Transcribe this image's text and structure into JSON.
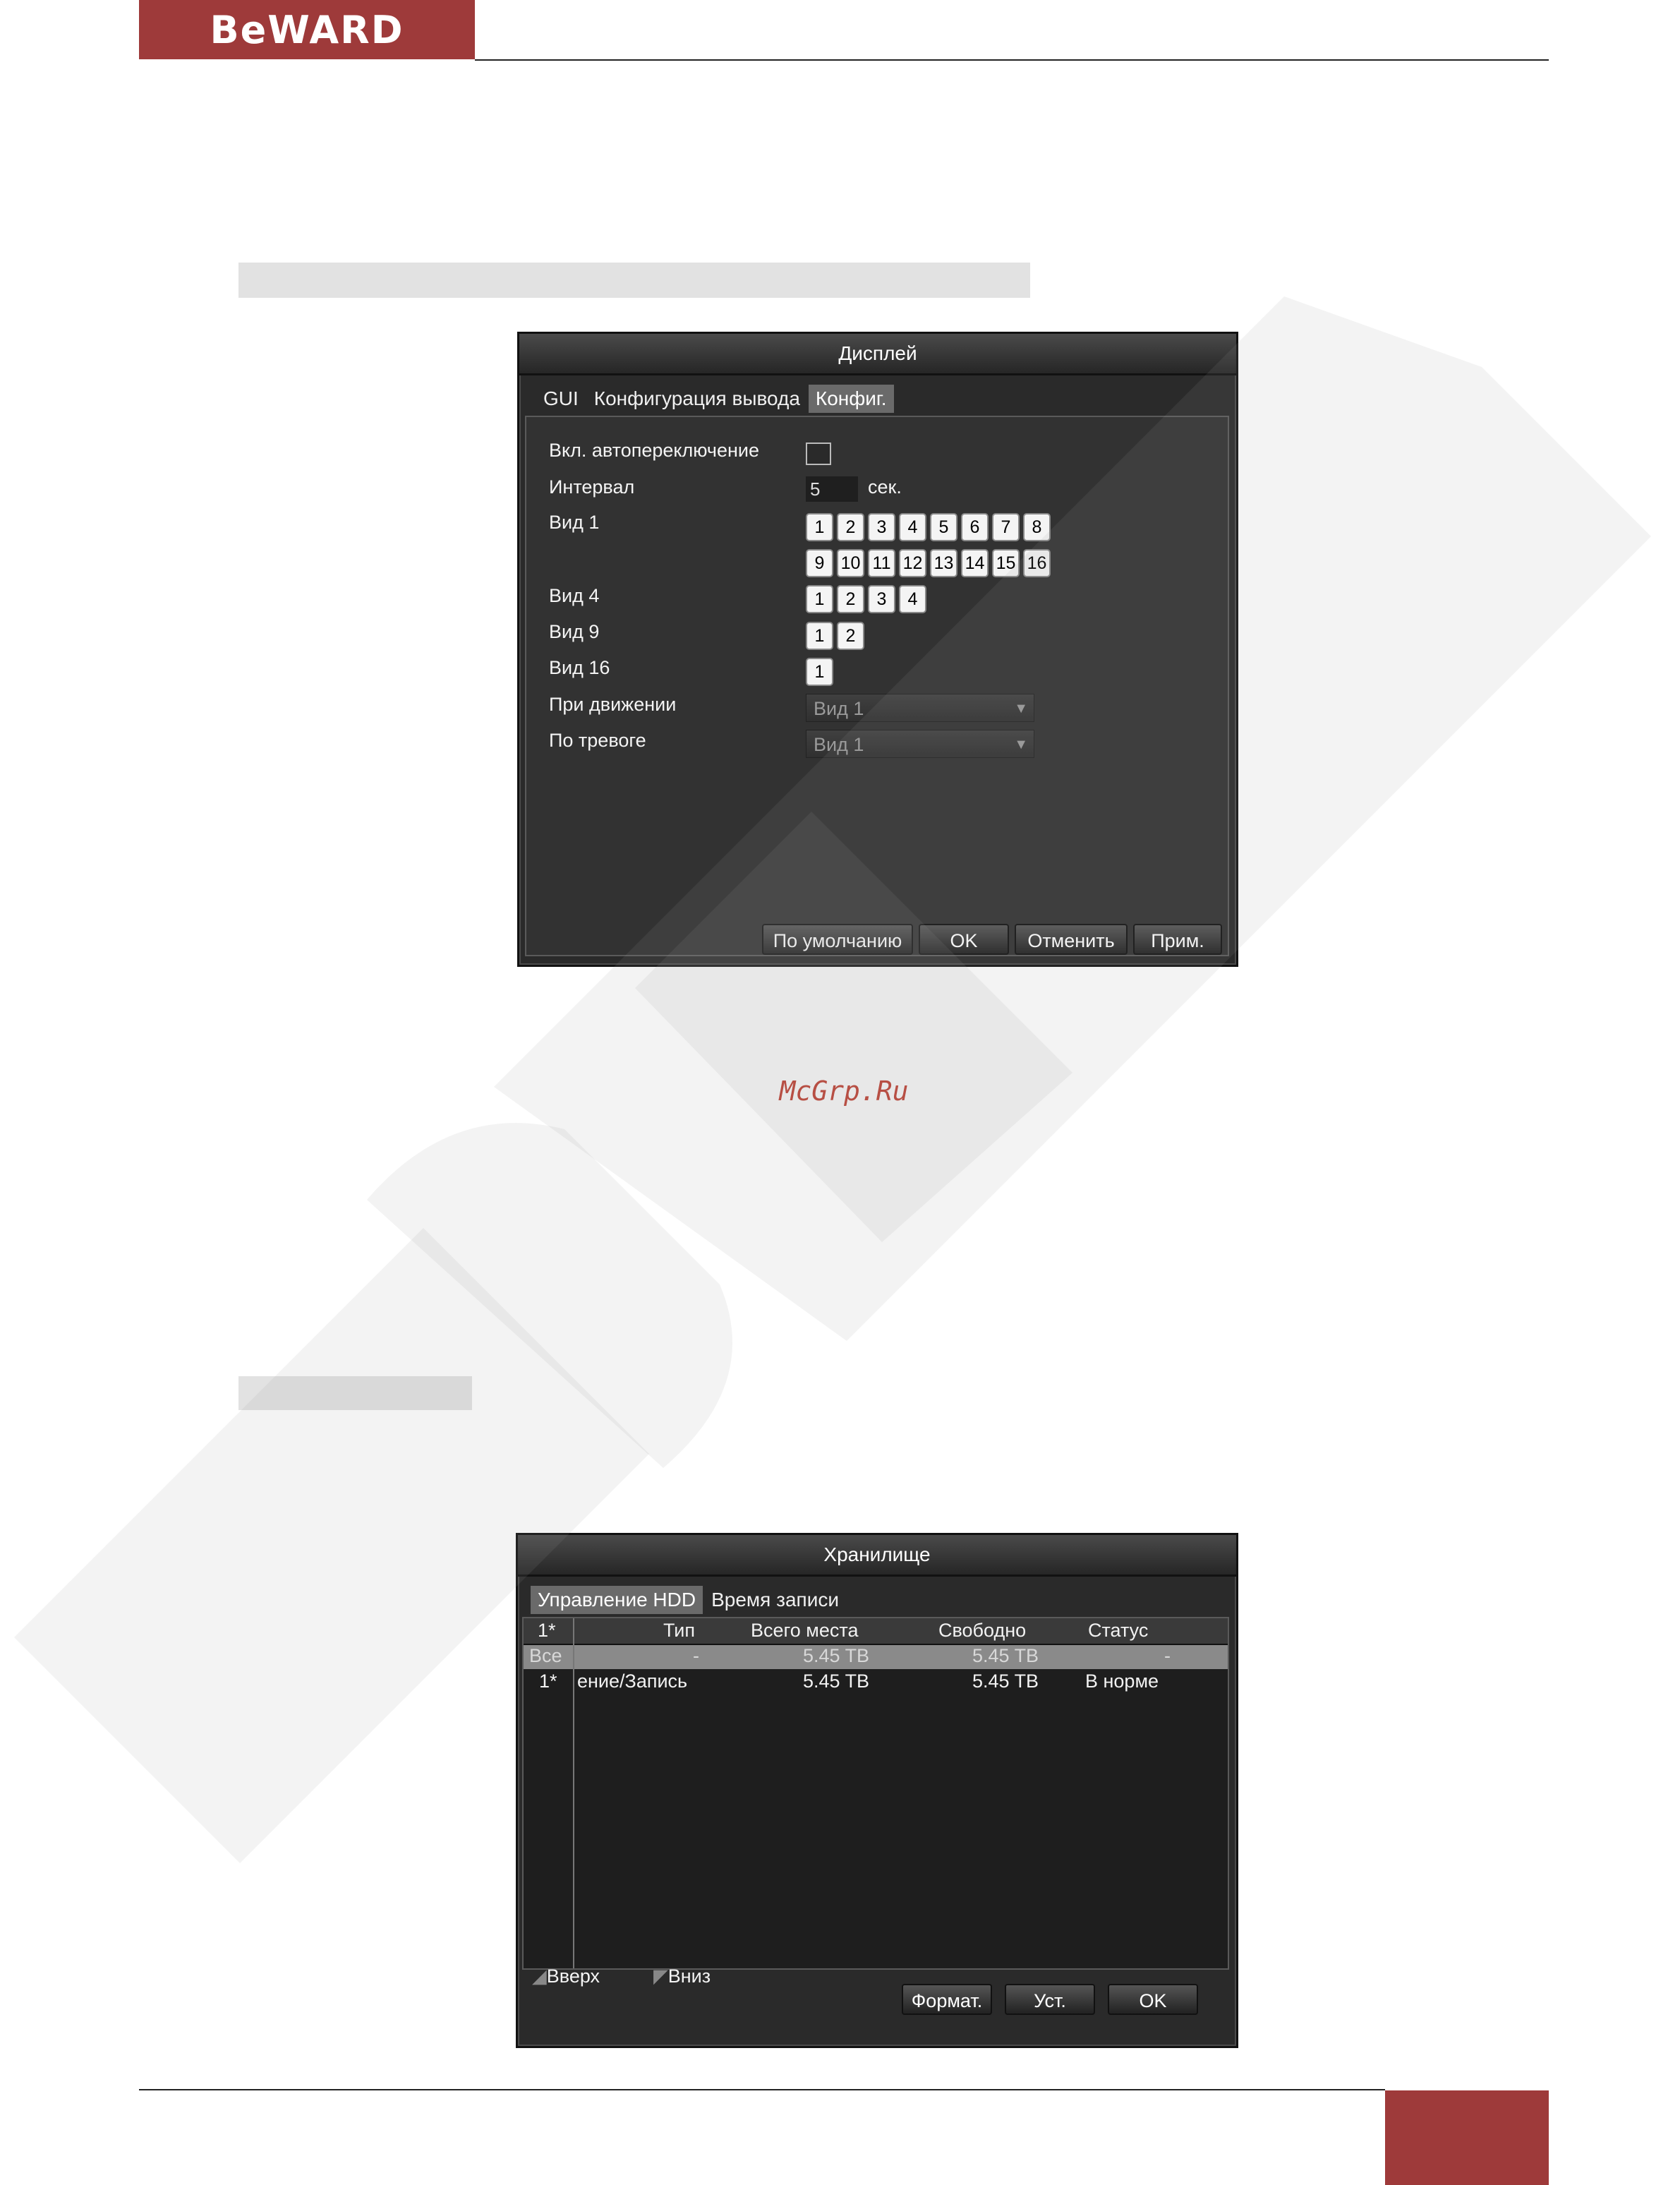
{
  "header": {
    "logo_text": "BeWARD"
  },
  "watermark": {
    "site": "McGrp.Ru"
  },
  "display_dialog": {
    "title": "Дисплей",
    "tabs": [
      {
        "label": "GUI",
        "active": false
      },
      {
        "label": "Конфигурация вывода",
        "active": false
      },
      {
        "label": "Конфиг.",
        "active": true
      }
    ],
    "rows": {
      "autoswitch_label": "Вкл. автопереключение",
      "autoswitch_checked": false,
      "interval_label": "Интервал",
      "interval_value": "5",
      "interval_unit": "сек.",
      "view1_label": "Вид 1",
      "view1_row1": [
        "1",
        "2",
        "3",
        "4",
        "5",
        "6",
        "7",
        "8"
      ],
      "view1_row2": [
        "9",
        "10",
        "11",
        "12",
        "13",
        "14",
        "15",
        "16"
      ],
      "view4_label": "Вид 4",
      "view4": [
        "1",
        "2",
        "3",
        "4"
      ],
      "view9_label": "Вид 9",
      "view9": [
        "1",
        "2"
      ],
      "view16_label": "Вид 16",
      "view16": [
        "1"
      ],
      "motion_label": "При движении",
      "motion_value": "Вид 1",
      "alarm_label": "По тревоге",
      "alarm_value": "Вид 1"
    },
    "buttons": {
      "default": "По умолчанию",
      "ok": "OK",
      "cancel": "Отменить",
      "apply": "Прим."
    }
  },
  "storage_dialog": {
    "title": "Хранилище",
    "tabs": [
      {
        "label": "Управление HDD",
        "active": true
      },
      {
        "label": "Время записи",
        "active": false
      }
    ],
    "columns": [
      "1*",
      "Тип",
      "Всего места",
      "Свободно",
      "Статус"
    ],
    "rows": [
      {
        "id": "Все",
        "type": "-",
        "total": "5.45 TB",
        "free": "5.45 TB",
        "status": "-",
        "selected": true
      },
      {
        "id": "1*",
        "type": "ение/Запись",
        "total": "5.45 TB",
        "free": "5.45 TB",
        "status": "В норме",
        "selected": false
      }
    ],
    "nav": {
      "up": "Вверх",
      "down": "Вниз"
    },
    "buttons": {
      "format": "Формат.",
      "set": "Уст.",
      "ok": "OK"
    }
  },
  "colors": {
    "brand": "#9e3a3a",
    "dialog_bg": "#2a2a2a",
    "link": "#c0392b"
  }
}
